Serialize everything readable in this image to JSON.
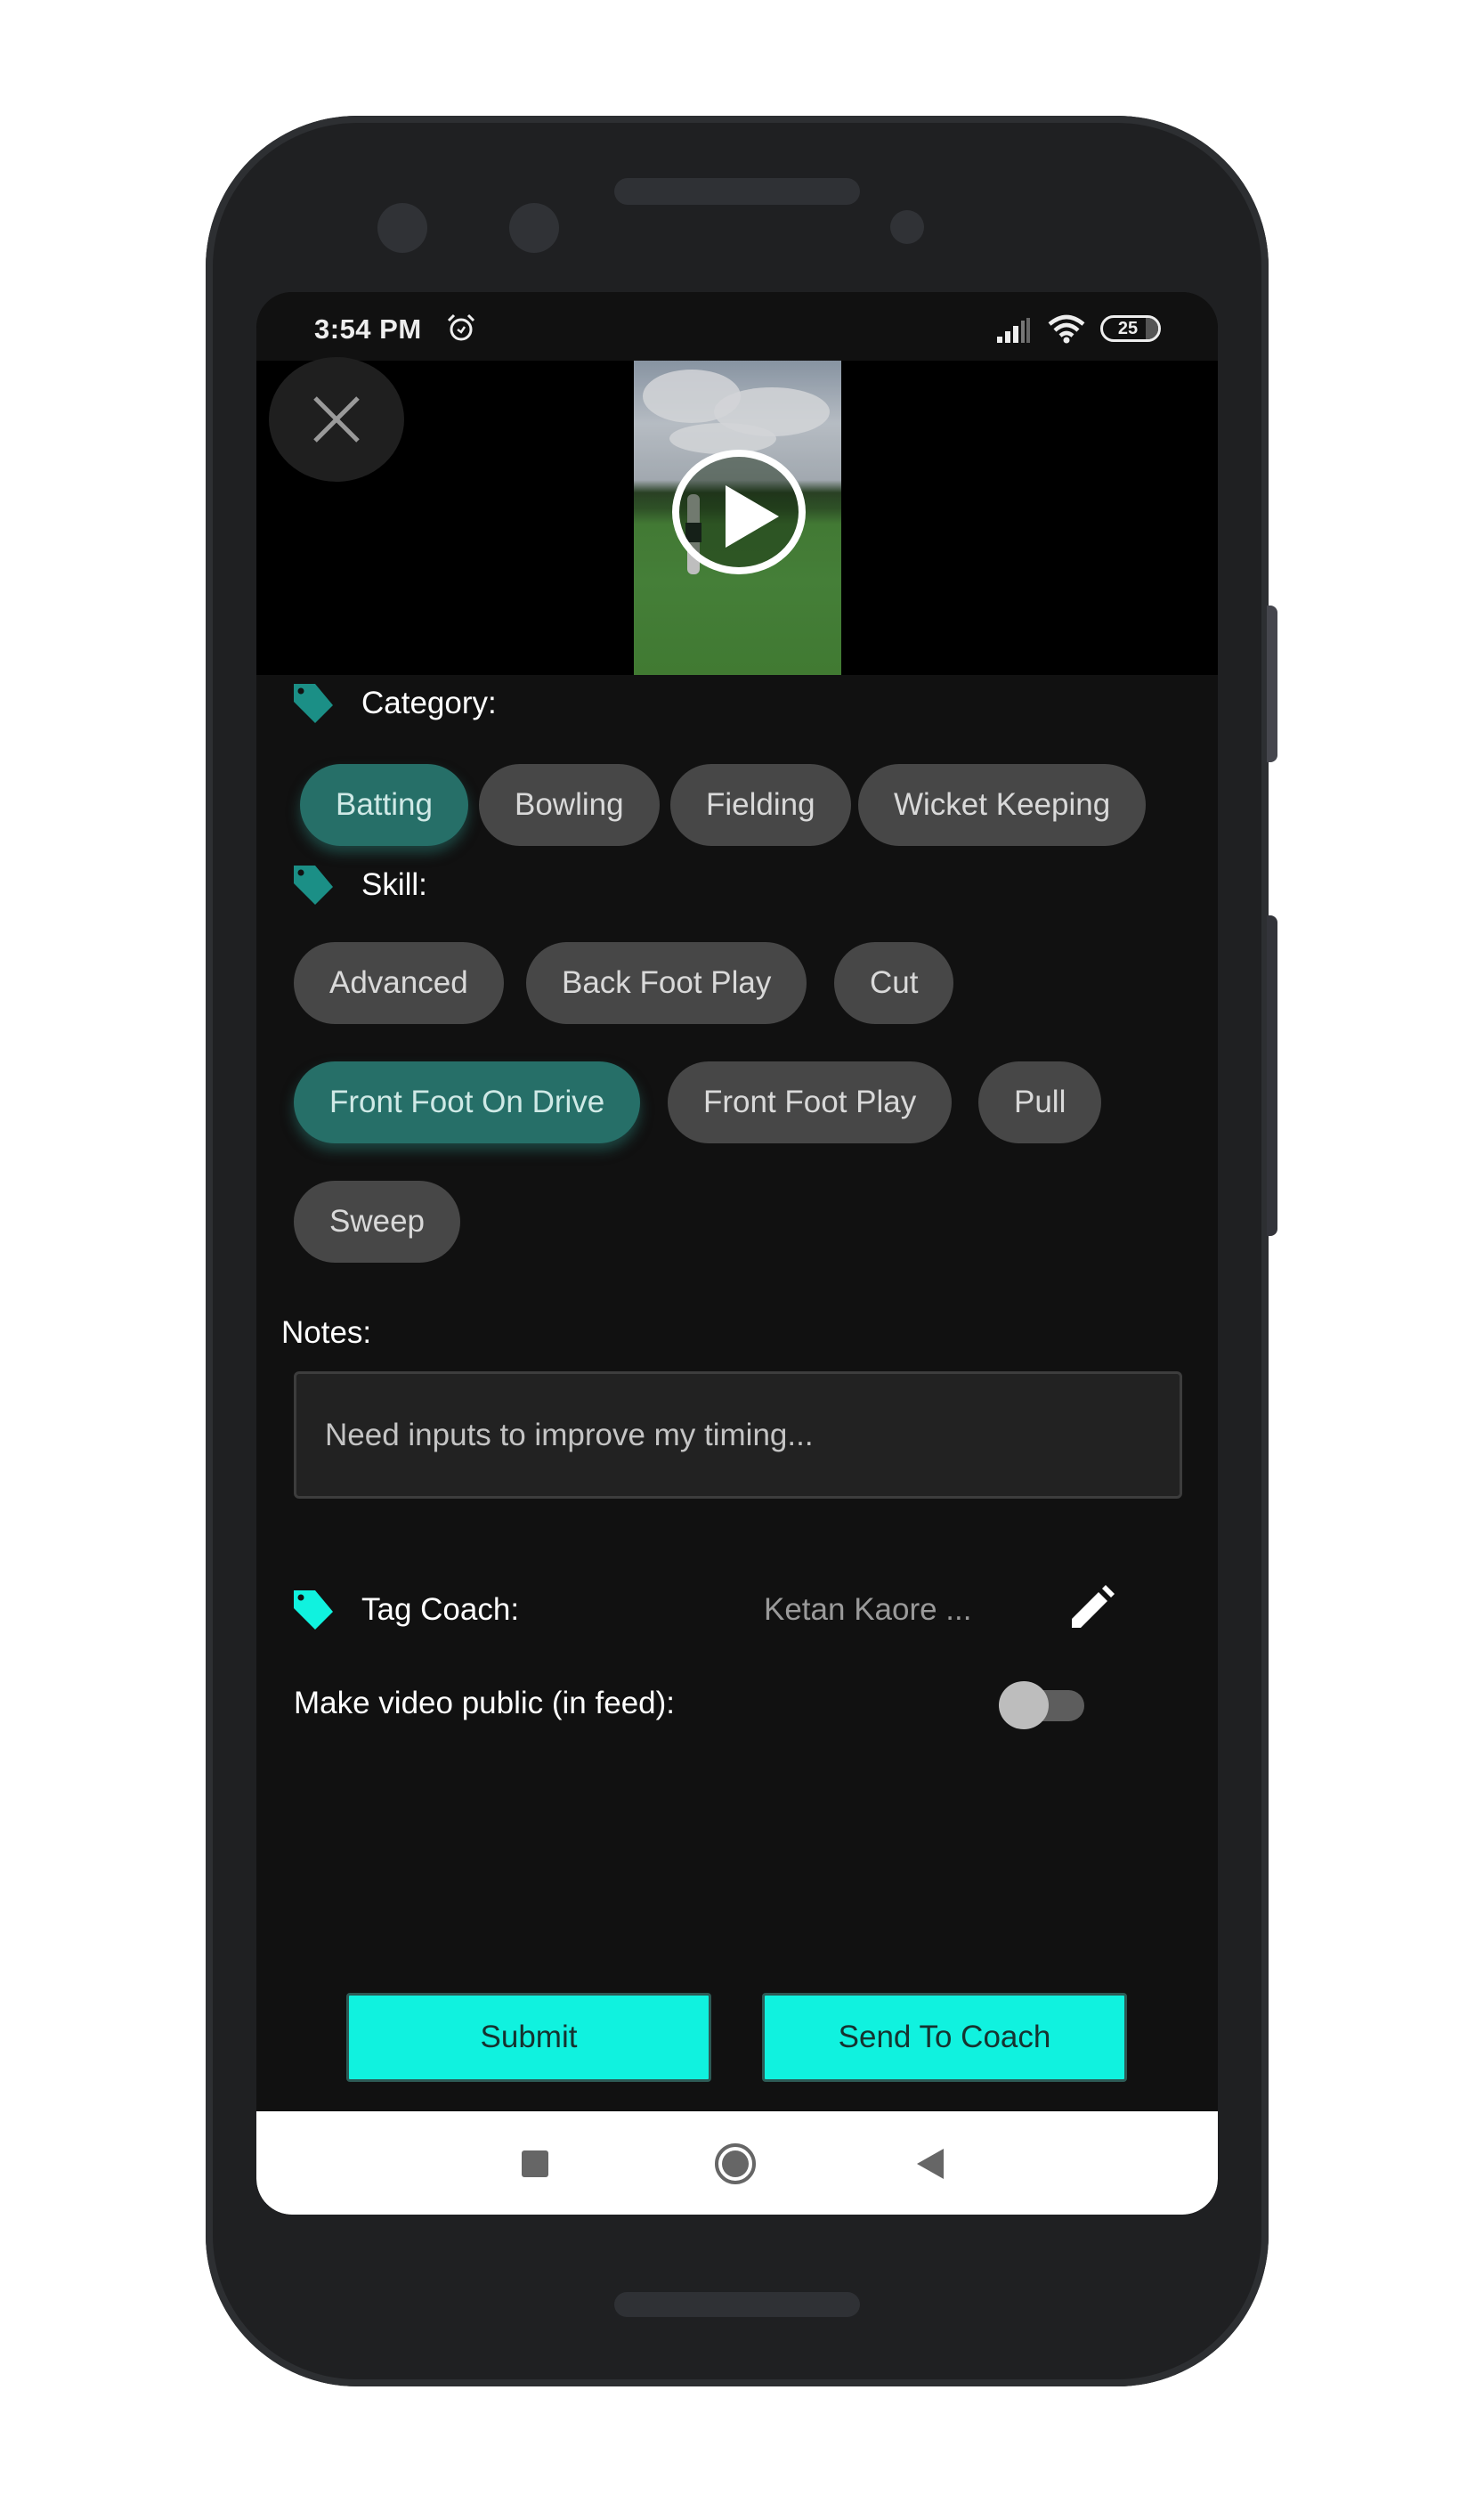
{
  "status_bar": {
    "time": "3:54 PM",
    "alarm_icon": "alarm-clock-icon",
    "signal_icon": "cellular-signal-icon",
    "wifi_icon": "wifi-icon",
    "battery_level": "25"
  },
  "video": {
    "close_icon": "close-icon",
    "play_icon": "play-icon"
  },
  "category": {
    "label": "Category:",
    "icon": "tag-icon",
    "options": [
      {
        "label": "Batting",
        "selected": true
      },
      {
        "label": "Bowling",
        "selected": false
      },
      {
        "label": "Fielding",
        "selected": false
      },
      {
        "label": "Wicket Keeping",
        "selected": false
      }
    ]
  },
  "skill": {
    "label": "Skill:",
    "icon": "tag-icon",
    "options": [
      {
        "label": "Advanced",
        "selected": false
      },
      {
        "label": "Back Foot Play",
        "selected": false
      },
      {
        "label": "Cut",
        "selected": false
      },
      {
        "label": "Front Foot On Drive",
        "selected": true
      },
      {
        "label": "Front Foot Play",
        "selected": false
      },
      {
        "label": "Pull",
        "selected": false
      },
      {
        "label": "Sweep",
        "selected": false
      }
    ]
  },
  "notes": {
    "label": "Notes:",
    "value": "Need inputs to improve my timing..."
  },
  "tag_coach": {
    "label": "Tag Coach:",
    "value": "Ketan Kaore ...",
    "edit_icon": "pencil-icon"
  },
  "public_toggle": {
    "label": "Make video public (in feed):",
    "on": false
  },
  "actions": {
    "submit_label": "Submit",
    "send_to_coach_label": "Send To Coach"
  },
  "colors": {
    "accent": "#10f2df",
    "chip_selected": "#266f68",
    "chip_default": "#474747",
    "tag_icon_teal": "#1b8f86",
    "tag_icon_cyan": "#10f2df",
    "background": "#111111"
  },
  "nav_bar": {
    "recent_icon": "recent-apps-icon",
    "home_icon": "home-icon",
    "back_icon": "back-icon"
  }
}
